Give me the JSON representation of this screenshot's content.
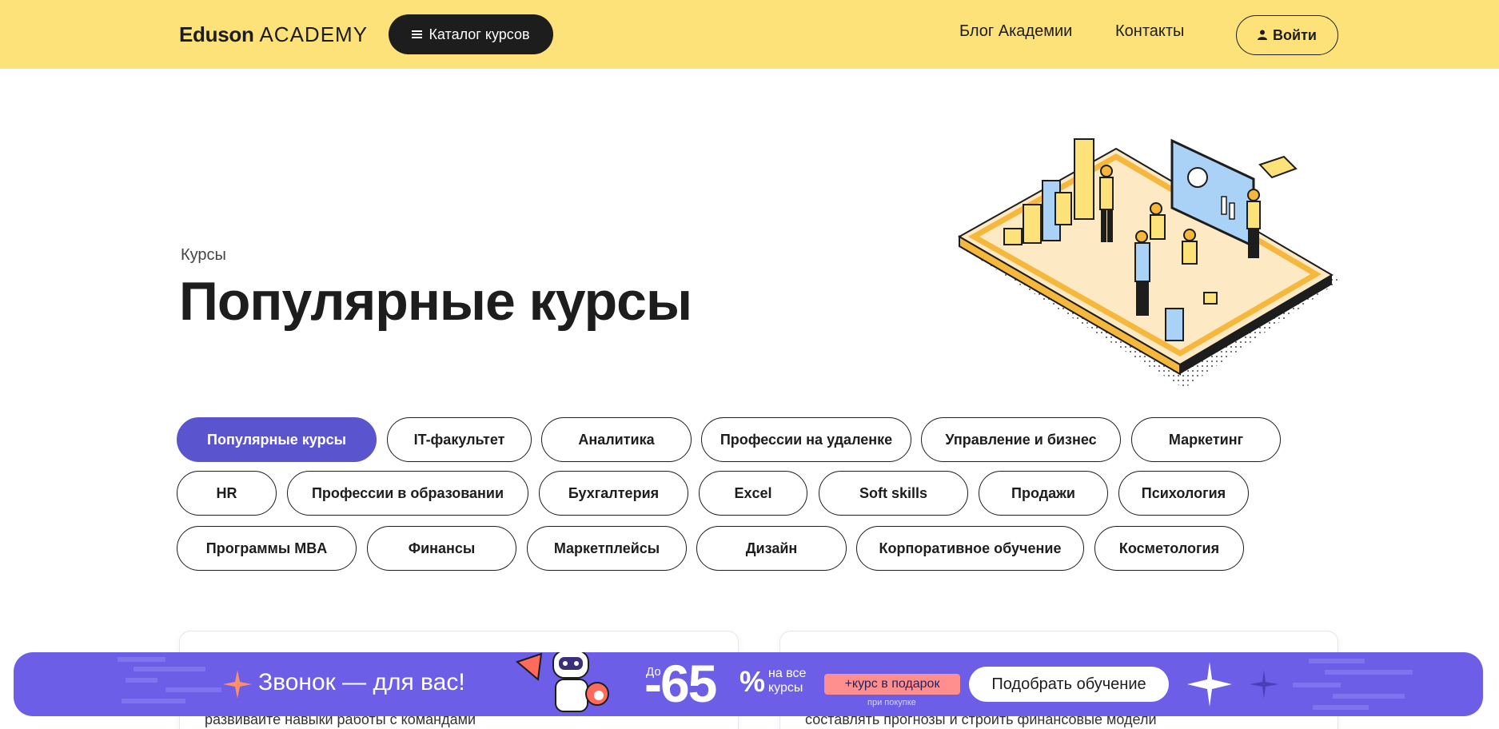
{
  "header": {
    "logo_brand": "Eduson",
    "logo_suffix": "ACADEMY",
    "catalog_label": "Каталог курсов",
    "blog_label": "Блог Академии",
    "contacts_label": "Контакты",
    "login_label": "Войти"
  },
  "hero": {
    "eyebrow": "Курсы",
    "title": "Популярные курсы"
  },
  "filters": [
    "Популярные курсы",
    "IT-факультет",
    "Аналитика",
    "Профессии на удаленке",
    "Управление и бизнес",
    "Маркетинг",
    "HR",
    "Профессии в образовании",
    "Бухгалтерия",
    "Excel",
    "Soft skills",
    "Продажи",
    "Психология",
    "Программы MBA",
    "Финансы",
    "Маркетплейсы",
    "Дизайн",
    "Корпоративное обучение",
    "Косметология"
  ],
  "active_filter": "Популярные курсы",
  "cards": [
    {
      "snippet": "развивайте навыки работы с командами"
    },
    {
      "snippet": "составлять прогнозы и строить финансовые модели"
    }
  ],
  "promo": {
    "title": "Звонок — для вас!",
    "prefix": "До",
    "discount": "-65",
    "percent": "%",
    "on_all_line1": "на все",
    "on_all_line2": "курсы",
    "gift": "+курс в подарок",
    "gift_note": "при покупке",
    "cta": "Подобрать обучение"
  },
  "colors": {
    "header_bg": "#fde27a",
    "accent": "#5a55cf",
    "promo_bg": "#6c5ee7",
    "gift_bg": "#ff8f8f",
    "text": "#1d1d1d"
  },
  "icons": {
    "catalog": "menu-icon",
    "login": "user-icon",
    "promo_left": "sparkle-icon",
    "promo_right": "sparkle-icon"
  }
}
